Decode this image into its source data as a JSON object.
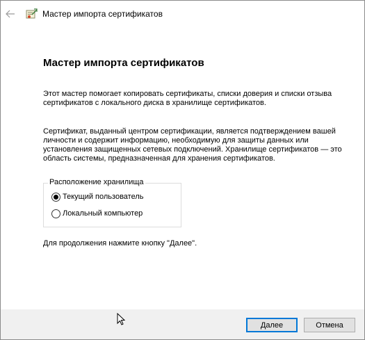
{
  "window": {
    "title": "Мастер импорта сертификатов"
  },
  "content": {
    "heading": "Мастер импорта сертификатов",
    "paragraph1": "Этот мастер помогает копировать сертификаты, списки доверия и списки отзыва сертификатов с локального диска в хранилище сертификатов.",
    "paragraph2": "Сертификат, выданный центром сертификации, является подтверждением вашей личности и содержит информацию, необходимую для защиты данных или установления защищенных сетевых подключений. Хранилище сертификатов — это область системы, предназначенная для хранения сертификатов.",
    "store_location": {
      "legend": "Расположение хранилища",
      "options": [
        {
          "label": "Текущий пользователь",
          "checked": true
        },
        {
          "label": "Локальный компьютер",
          "checked": false
        }
      ]
    },
    "hint": "Для продолжения нажмите кнопку \"Далее\"."
  },
  "footer": {
    "next_label": "Далее",
    "cancel_label": "Отмена"
  },
  "icons": {
    "back": "back-arrow-icon",
    "app": "certificate-wizard-icon",
    "cursor": "mouse-pointer-icon"
  },
  "colors": {
    "accent": "#0078d7",
    "footer_bg": "#f0f0f0",
    "button_bg": "#e1e1e1"
  }
}
